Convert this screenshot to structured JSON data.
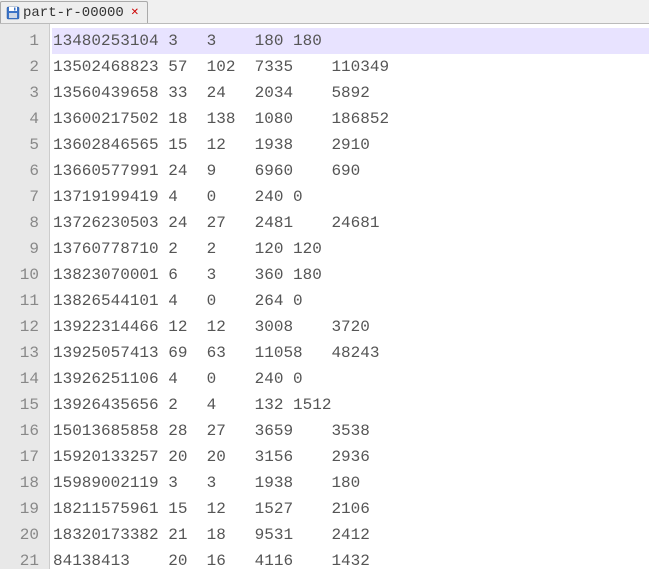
{
  "tab": {
    "filename": "part-r-00000",
    "close_glyph": "✕"
  },
  "rows": [
    {
      "n": "1",
      "c0": "13480253104",
      "c1": "3",
      "c2": "3",
      "c34": "180 180",
      "highlight": true
    },
    {
      "n": "2",
      "c0": "13502468823",
      "c1": "57",
      "c2": "102",
      "c3": "7335",
      "c4": "110349"
    },
    {
      "n": "3",
      "c0": "13560439658",
      "c1": "33",
      "c2": "24",
      "c3": "2034",
      "c4": "5892"
    },
    {
      "n": "4",
      "c0": "13600217502",
      "c1": "18",
      "c2": "138",
      "c3": "1080",
      "c4": "186852"
    },
    {
      "n": "5",
      "c0": "13602846565",
      "c1": "15",
      "c2": "12",
      "c3": "1938",
      "c4": "2910"
    },
    {
      "n": "6",
      "c0": "13660577991",
      "c1": "24",
      "c2": "9",
      "c3": "6960",
      "c4": "690"
    },
    {
      "n": "7",
      "c0": "13719199419",
      "c1": "4",
      "c2": "0",
      "c34": "240 0"
    },
    {
      "n": "8",
      "c0": "13726230503",
      "c1": "24",
      "c2": "27",
      "c3": "2481",
      "c4": "24681"
    },
    {
      "n": "9",
      "c0": "13760778710",
      "c1": "2",
      "c2": "2",
      "c34": "120 120"
    },
    {
      "n": "10",
      "c0": "13823070001",
      "c1": "6",
      "c2": "3",
      "c34": "360 180"
    },
    {
      "n": "11",
      "c0": "13826544101",
      "c1": "4",
      "c2": "0",
      "c34": "264 0"
    },
    {
      "n": "12",
      "c0": "13922314466",
      "c1": "12",
      "c2": "12",
      "c3": "3008",
      "c4": "3720"
    },
    {
      "n": "13",
      "c0": "13925057413",
      "c1": "69",
      "c2": "63",
      "c3": "11058",
      "c4": "48243"
    },
    {
      "n": "14",
      "c0": "13926251106",
      "c1": "4",
      "c2": "0",
      "c34": "240 0"
    },
    {
      "n": "15",
      "c0": "13926435656",
      "c1": "2",
      "c2": "4",
      "c34": "132 1512"
    },
    {
      "n": "16",
      "c0": "15013685858",
      "c1": "28",
      "c2": "27",
      "c3": "3659",
      "c4": "3538"
    },
    {
      "n": "17",
      "c0": "15920133257",
      "c1": "20",
      "c2": "20",
      "c3": "3156",
      "c4": "2936"
    },
    {
      "n": "18",
      "c0": "15989002119",
      "c1": "3",
      "c2": "3",
      "c3": "1938",
      "c4": "180"
    },
    {
      "n": "19",
      "c0": "18211575961",
      "c1": "15",
      "c2": "12",
      "c3": "1527",
      "c4": "2106"
    },
    {
      "n": "20",
      "c0": "18320173382",
      "c1": "21",
      "c2": "18",
      "c3": "9531",
      "c4": "2412"
    },
    {
      "n": "21",
      "c0": "84138413",
      "c1": "20",
      "c2": "16",
      "c3": "4116",
      "c4": "1432"
    }
  ]
}
